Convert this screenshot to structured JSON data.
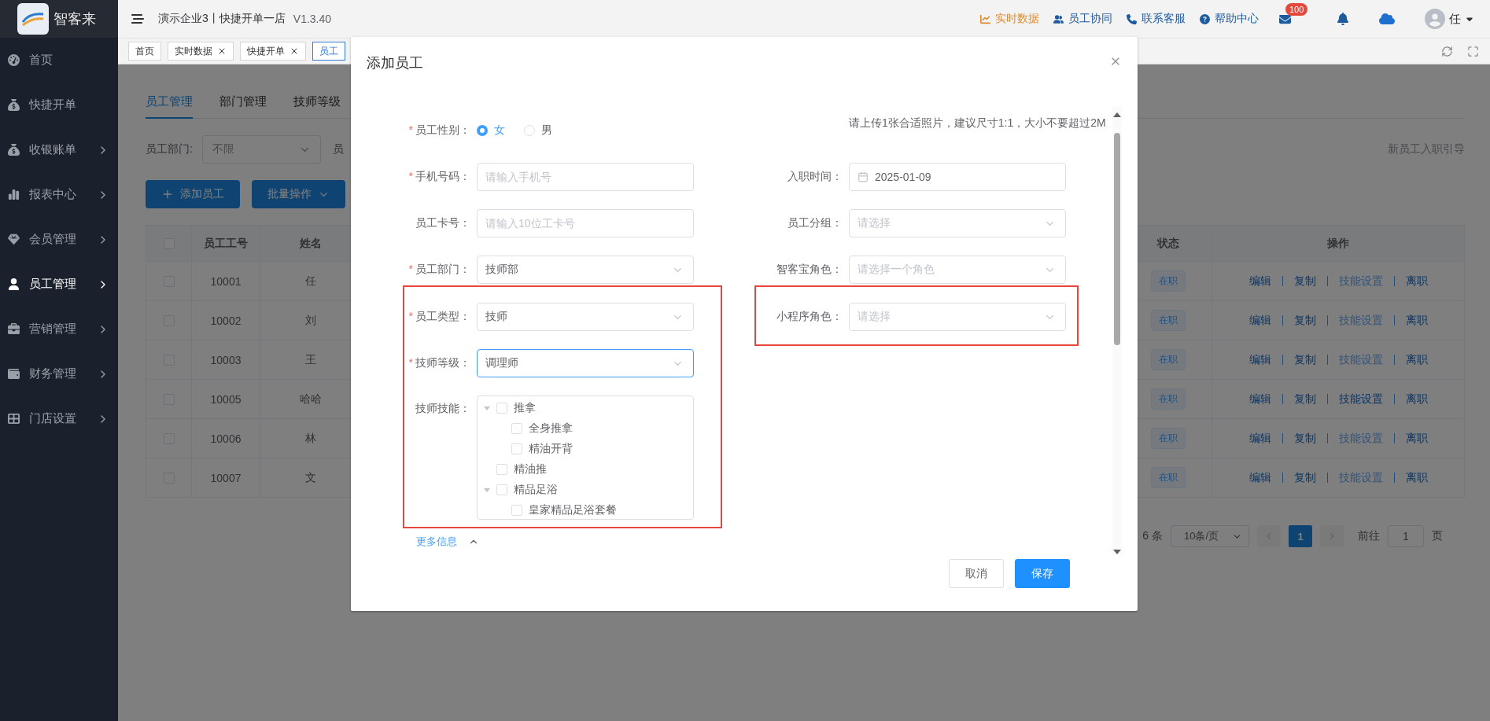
{
  "brand": {
    "name": "智客来"
  },
  "topbar": {
    "company": "演示企业3丨快捷开单一店",
    "version": "V1.3.40",
    "links": [
      {
        "label": "实时数据",
        "color": "#e08a2c"
      },
      {
        "label": "员工协同",
        "color": "#1d5a9e"
      },
      {
        "label": "联系客服",
        "color": "#1d5a9e"
      },
      {
        "label": "帮助中心",
        "color": "#1d5a9e"
      }
    ],
    "mail_badge": "100",
    "user": "任"
  },
  "sidebar": {
    "items": [
      {
        "label": "首页",
        "expandable": false,
        "selected": false
      },
      {
        "label": "快捷开单",
        "expandable": false,
        "selected": false
      },
      {
        "label": "收银账单",
        "expandable": true,
        "selected": false
      },
      {
        "label": "报表中心",
        "expandable": true,
        "selected": false
      },
      {
        "label": "会员管理",
        "expandable": true,
        "selected": false
      },
      {
        "label": "员工管理",
        "expandable": true,
        "selected": true
      },
      {
        "label": "营销管理",
        "expandable": true,
        "selected": false
      },
      {
        "label": "财务管理",
        "expandable": true,
        "selected": false
      },
      {
        "label": "门店设置",
        "expandable": true,
        "selected": false
      }
    ]
  },
  "page_tabs": [
    {
      "label": "首页",
      "closable": false,
      "selected": false
    },
    {
      "label": "实时数据",
      "closable": true,
      "selected": false
    },
    {
      "label": "快捷开单",
      "closable": true,
      "selected": false
    },
    {
      "label": "员工",
      "closable": false,
      "selected": true
    }
  ],
  "sub_tabs": [
    {
      "label": "员工管理",
      "selected": true
    },
    {
      "label": "部门管理",
      "selected": false
    },
    {
      "label": "技师等级",
      "selected": false
    }
  ],
  "filters": {
    "department_label": "员工部门:",
    "department_placeholder": "不限",
    "next_label": "员"
  },
  "guide_link": "新员工入职引导",
  "actions": {
    "add": "添加员工",
    "batch": "批量操作"
  },
  "table": {
    "all_checked": false,
    "columns": {
      "id": "员工工号",
      "name": "姓名",
      "status": "状态",
      "ops": "操作"
    },
    "rows": [
      {
        "id": "10001",
        "name": "任",
        "status": "在职",
        "checked": false,
        "actions": [
          {
            "label": "编辑",
            "disabled": false
          },
          {
            "label": "复制",
            "disabled": false
          },
          {
            "label": "技能设置",
            "disabled": true
          },
          {
            "label": "离职",
            "disabled": false
          }
        ]
      },
      {
        "id": "10002",
        "name": "刘",
        "status": "在职",
        "checked": false,
        "actions": [
          {
            "label": "编辑",
            "disabled": false
          },
          {
            "label": "复制",
            "disabled": false
          },
          {
            "label": "技能设置",
            "disabled": true
          },
          {
            "label": "离职",
            "disabled": false
          }
        ]
      },
      {
        "id": "10003",
        "name": "王",
        "status": "在职",
        "checked": false,
        "actions": [
          {
            "label": "编辑",
            "disabled": false
          },
          {
            "label": "复制",
            "disabled": false
          },
          {
            "label": "技能设置",
            "disabled": true
          },
          {
            "label": "离职",
            "disabled": false
          }
        ]
      },
      {
        "id": "10005",
        "name": "哈哈",
        "status": "在职",
        "checked": false,
        "actions": [
          {
            "label": "编辑",
            "disabled": false
          },
          {
            "label": "复制",
            "disabled": false
          },
          {
            "label": "技能设置",
            "disabled": false
          },
          {
            "label": "离职",
            "disabled": false
          }
        ]
      },
      {
        "id": "10006",
        "name": "林",
        "status": "在职",
        "checked": false,
        "actions": [
          {
            "label": "编辑",
            "disabled": false
          },
          {
            "label": "复制",
            "disabled": false
          },
          {
            "label": "技能设置",
            "disabled": true
          },
          {
            "label": "离职",
            "disabled": false
          }
        ]
      },
      {
        "id": "10007",
        "name": "文",
        "status": "在职",
        "checked": false,
        "actions": [
          {
            "label": "编辑",
            "disabled": false
          },
          {
            "label": "复制",
            "disabled": false
          },
          {
            "label": "技能设置",
            "disabled": true
          },
          {
            "label": "离职",
            "disabled": false
          }
        ]
      }
    ]
  },
  "pagination": {
    "total": "6 条",
    "page_size": "10条/页",
    "pages": [
      {
        "label": "1",
        "selected": true
      }
    ],
    "goto_label": "前往",
    "goto_value": "1",
    "goto_suffix": "页"
  },
  "dialog": {
    "title": "添加员工",
    "left_fields": [
      {
        "kind": "radio",
        "label": "员工性别：",
        "required_mark": "*",
        "highlighted": false,
        "options": [
          {
            "label": "女",
            "selected": true
          },
          {
            "label": "男",
            "selected": false
          }
        ]
      },
      {
        "kind": "input",
        "label": "手机号码：",
        "required_mark": "*",
        "highlighted": false,
        "placeholder": "请输入手机号"
      },
      {
        "kind": "input",
        "label": "员工卡号：",
        "highlighted": false,
        "placeholder": "请输入10位工卡号"
      },
      {
        "kind": "select",
        "label": "员工部门：",
        "required_mark": "*",
        "highlighted": false,
        "value": "技师部",
        "focused": false
      },
      {
        "kind": "select",
        "label": "员工类型：",
        "required_mark": "*",
        "highlighted": true,
        "value": "技师",
        "focused": false
      },
      {
        "kind": "select",
        "label": "技师等级：",
        "required_mark": "*",
        "highlighted": true,
        "value": "调理师",
        "focused": true
      },
      {
        "kind": "tree",
        "label": "技师技能：",
        "highlighted": true,
        "items": [
          {
            "label": "推拿",
            "checked": false,
            "expanded": true,
            "children": [
              {
                "label": "全身推拿",
                "checked": false
              },
              {
                "label": "精油开背",
                "checked": false
              }
            ]
          },
          {
            "label": "精油推",
            "checked": false
          },
          {
            "label": "精品足浴",
            "checked": false,
            "expanded": true,
            "children": [
              {
                "label": "皇家精品足浴套餐",
                "checked": false
              }
            ]
          }
        ]
      }
    ],
    "right_fields": [
      {
        "kind": "note",
        "text": "请上传1张合适照片，建议尺寸1:1，大小不要超过2M",
        "highlighted": false
      },
      {
        "kind": "date",
        "label": "入职时间：",
        "value": "2025-01-09",
        "highlighted": false
      },
      {
        "kind": "select",
        "label": "员工分组：",
        "placeholder": "请选择",
        "highlighted": false,
        "focused": false
      },
      {
        "kind": "select",
        "label": "智客宝角色：",
        "placeholder": "请选择一个角色",
        "highlighted": false,
        "focused": false
      },
      {
        "kind": "select",
        "label": "小程序角色：",
        "placeholder": "请选择",
        "highlighted": true,
        "focused": false
      }
    ],
    "more_link": {
      "label": "更多信息",
      "expanded": true
    },
    "buttons": {
      "cancel": "取消",
      "save": "保存"
    }
  }
}
